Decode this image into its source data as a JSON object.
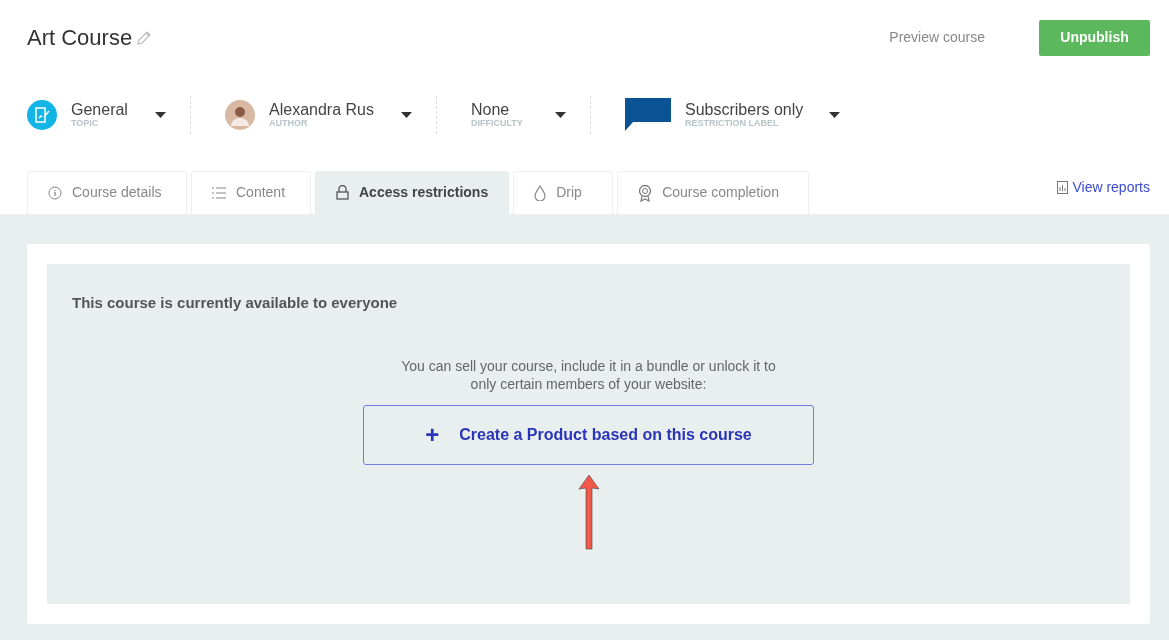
{
  "title": "Art Course",
  "header_buttons": [
    {
      "kind": "link",
      "label": "Preview course"
    },
    {
      "kind": "primary",
      "label": "Unpublish"
    }
  ],
  "selectors": [
    {
      "kind": "topic",
      "value": "General",
      "caption": "TOPIC"
    },
    {
      "kind": "author",
      "value": "Alexandra Rus",
      "caption": "AUTHOR"
    },
    {
      "kind": "plain",
      "value": "None",
      "caption": "DIFFICULTY"
    },
    {
      "kind": "label",
      "value": "Subscribers only",
      "caption": "RESTRICTION LABEL",
      "color": "#0b5394"
    }
  ],
  "tabs": [
    {
      "label": "Course details",
      "selected": false
    },
    {
      "label": "Content",
      "selected": false
    },
    {
      "label": "Access restrictions",
      "selected": true
    },
    {
      "label": "Drip",
      "selected": false
    },
    {
      "label": "Course completion",
      "selected": false
    }
  ],
  "reports_link": "View reports",
  "panel": {
    "heading": "This course is currently available to everyone",
    "description": "You can sell your course, include it in a bundle or unlock it to only certain members of your website:",
    "button": {
      "icon_text": "+",
      "label": "Create a Product based on this course"
    }
  }
}
